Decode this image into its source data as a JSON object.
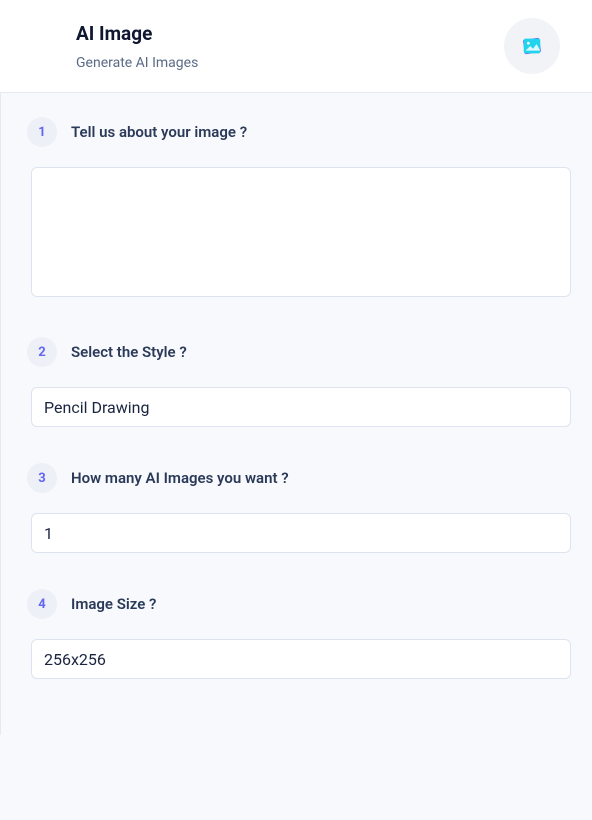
{
  "header": {
    "title": "AI Image",
    "subtitle": "Generate AI Images"
  },
  "steps": [
    {
      "number": "1",
      "label": "Tell us about your image ?",
      "value": ""
    },
    {
      "number": "2",
      "label": "Select the Style ?",
      "value": "Pencil Drawing"
    },
    {
      "number": "3",
      "label": "How many AI Images you want ?",
      "value": "1"
    },
    {
      "number": "4",
      "label": "Image Size ?",
      "value": "256x256"
    }
  ]
}
